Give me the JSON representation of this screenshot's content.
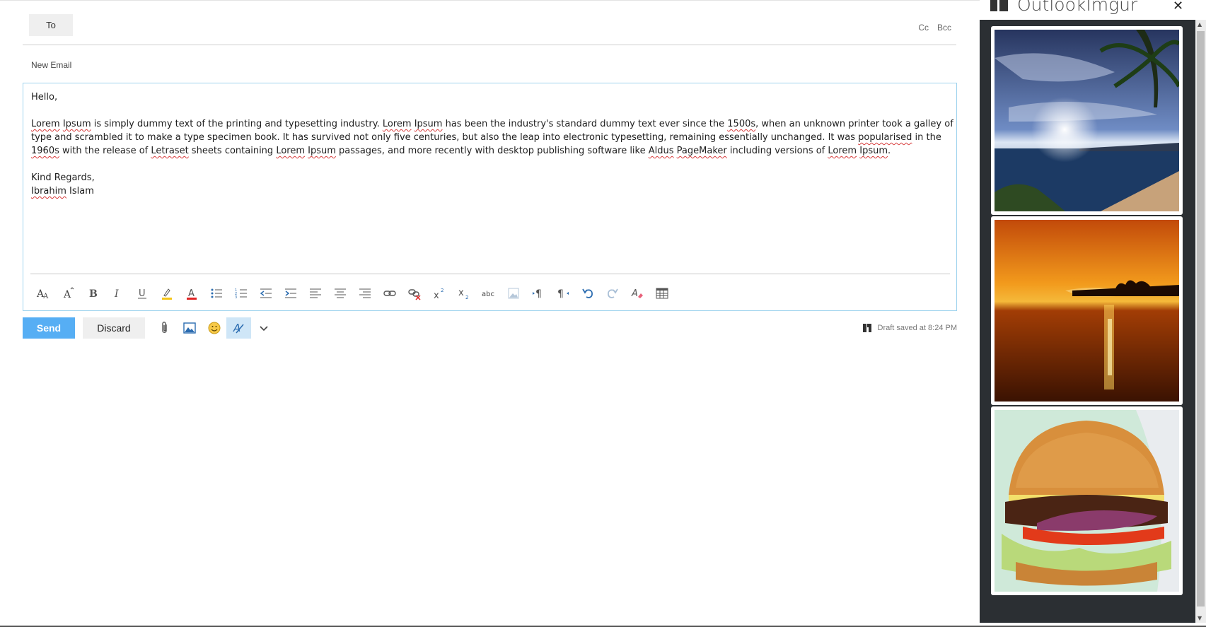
{
  "header": {
    "to_label": "To",
    "cc_label": "Cc",
    "bcc_label": "Bcc",
    "subject": "New Email"
  },
  "body": {
    "greeting": "Hello,",
    "paragraph": [
      {
        "t": "Lorem",
        "sq": true
      },
      {
        "t": " "
      },
      {
        "t": "Ipsum",
        "sq": true
      },
      {
        "t": " is simply dummy text of the printing and typesetting industry. "
      },
      {
        "t": "Lorem",
        "sq": true
      },
      {
        "t": " "
      },
      {
        "t": "Ipsum",
        "sq": true
      },
      {
        "t": " has been the industry's standard dummy text ever since the "
      },
      {
        "t": "1500s",
        "sq": true
      },
      {
        "t": ", when an unknown printer took a galley of type and scrambled it to make a type specimen book. It has survived not only five centuries, but also the leap into electronic typesetting, remaining essentially unchanged. It was "
      },
      {
        "t": "popularised",
        "sq": true
      },
      {
        "t": " in the "
      },
      {
        "t": "1960s",
        "sq": true
      },
      {
        "t": " with the release of "
      },
      {
        "t": "Letraset",
        "sq": true
      },
      {
        "t": " sheets containing "
      },
      {
        "t": "Lorem",
        "sq": true
      },
      {
        "t": " "
      },
      {
        "t": "Ipsum",
        "sq": true
      },
      {
        "t": " passages, and more recently with desktop publishing software like "
      },
      {
        "t": "Aldus",
        "sq": true
      },
      {
        "t": " "
      },
      {
        "t": "PageMaker",
        "sq": true
      },
      {
        "t": " including versions of "
      },
      {
        "t": "Lorem",
        "sq": true
      },
      {
        "t": " "
      },
      {
        "t": "Ipsum",
        "sq": true
      },
      {
        "t": "."
      }
    ],
    "closing": "Kind Regards,",
    "signature_first": "Ibrahim",
    "signature_last": " Islam"
  },
  "toolbar": {
    "icons": [
      "font-size-icon",
      "grow-font-icon",
      "bold-icon",
      "italic-icon",
      "underline-icon",
      "highlight-icon",
      "font-color-icon",
      "bullets-icon",
      "numbering-icon",
      "decrease-indent-icon",
      "increase-indent-icon",
      "align-left-icon",
      "align-center-icon",
      "align-right-icon",
      "insert-link-icon",
      "remove-link-icon",
      "superscript-icon",
      "subscript-icon",
      "strikethrough-icon",
      "insert-picture-icon",
      "ltr-icon",
      "rtl-icon",
      "undo-icon",
      "redo-icon",
      "clear-formatting-icon",
      "insert-table-icon"
    ],
    "strike_glyph": "abc"
  },
  "actions": {
    "send_label": "Send",
    "discard_label": "Discard",
    "draft_status": "Draft saved at 8:24 PM",
    "icons": [
      "attach-icon",
      "picture-icon",
      "emoji-icon",
      "addin-icon",
      "more-options-icon"
    ]
  },
  "addin": {
    "title": "OutlookImgur",
    "close_glyph": "✕",
    "images": [
      "beach-sunset-image",
      "ocean-sunset-image",
      "burger-image"
    ]
  },
  "colors": {
    "accent": "#56aef4",
    "editor_border": "#9fd3ee",
    "panel_bg": "#2b2f33",
    "spelling": "#d83b3b",
    "font_color_bar": "#e02424",
    "highlight_bar": "#f5c518"
  }
}
